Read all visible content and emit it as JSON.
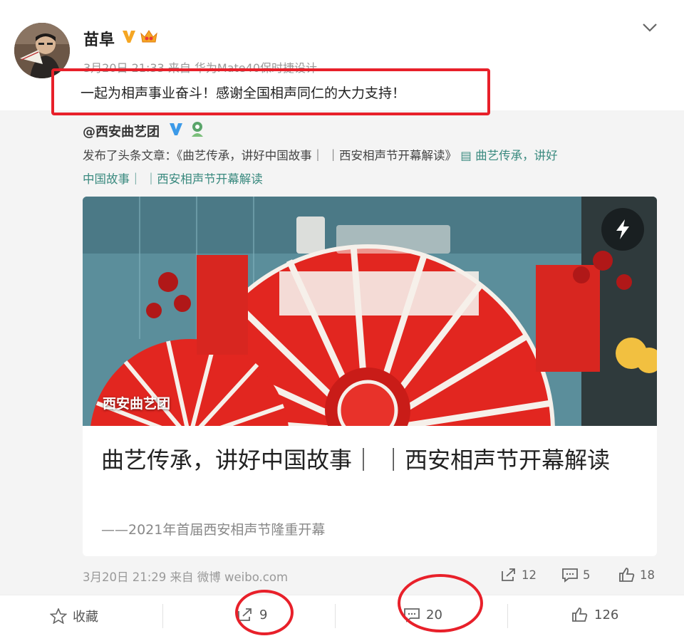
{
  "post": {
    "author": "苗阜",
    "meta": "3月20日 21:33 来自 华为Mate40保时捷设计",
    "text": "一起为相声事业奋斗！感谢全国相声同仁的大力支持！"
  },
  "repost": {
    "author": "@西安曲艺团",
    "line1_prefix": "发布了头条文章：《曲艺传承，讲好中国故事｜ ｜西安相声节开幕解读》",
    "line1_link": "▤ 曲艺传承，讲好",
    "line2": "中国故事｜ ｜西安相声节开幕解读",
    "card": {
      "image_tag": "西安曲艺团",
      "title": "曲艺传承，讲好中国故事｜ ｜西安相声节开幕解读",
      "subtitle": "——2021年首届西安相声节隆重开幕"
    },
    "meta": "3月20日 21:29 来自 微博 weibo.com",
    "actions": {
      "repost": "12",
      "comment": "5",
      "like": "18"
    }
  },
  "bottom_bar": {
    "favorite": "收藏",
    "repost": "9",
    "comment": "20",
    "like": "126"
  },
  "colors": {
    "annotation": "#e8202a",
    "link": "#3a8a7f",
    "verified": "#f5a623",
    "blue_v": "#3c9ae8"
  }
}
